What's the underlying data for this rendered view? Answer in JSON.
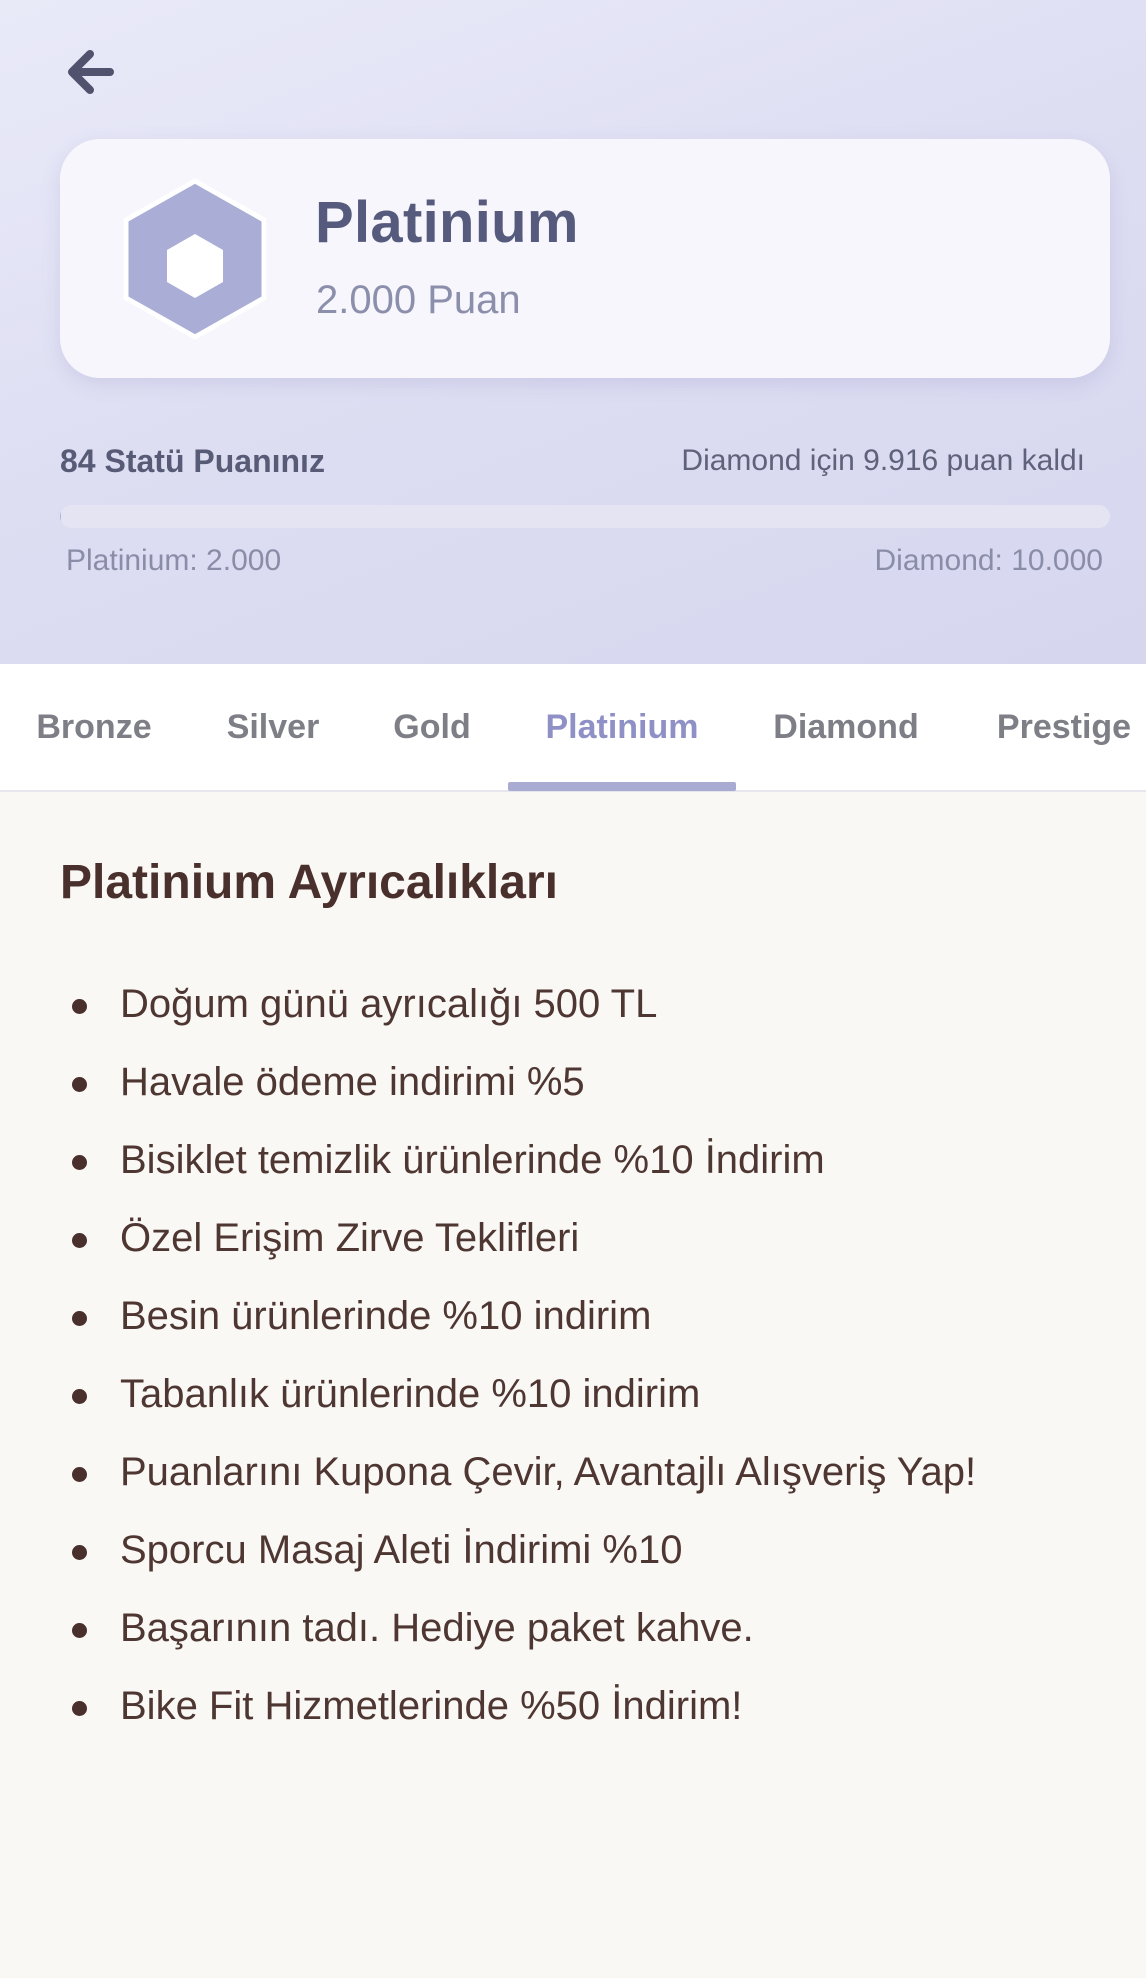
{
  "header": {
    "back_icon": "arrow-left-icon",
    "tier": {
      "icon": "hexagon-badge-icon",
      "name": "Platinium",
      "points": "2.000 Puan"
    },
    "status": {
      "label": "84 Statü Puanınız",
      "remaining": "Diamond için 9.916 puan kaldı",
      "progress_fraction": 0.001,
      "range_min": "Platinium: 2.000",
      "range_max": "Diamond: 10.000"
    }
  },
  "tabs": [
    {
      "label": "Bronze",
      "active": false
    },
    {
      "label": "Silver",
      "active": false
    },
    {
      "label": "Gold",
      "active": false
    },
    {
      "label": "Platinium",
      "active": true
    },
    {
      "label": "Diamond",
      "active": false
    },
    {
      "label": "Prestige",
      "active": false
    }
  ],
  "content": {
    "title": "Platinium Ayrıcalıkları",
    "benefits": [
      "Doğum günü ayrıcalığı 500 TL",
      "Havale ödeme indirimi %5",
      "Bisiklet temizlik ürünlerinde %10 İndirim",
      "Özel Erişim Zirve Teklifleri",
      "Besin ürünlerinde %10 indirim",
      "Tabanlık ürünlerinde %10 indirim",
      "Puanlarını Kupona Çevir, Avantajlı Alışveriş Yap!",
      "Sporcu Masaj Aleti İndirimi %10",
      "Başarının tadı. Hediye paket kahve.",
      "Bike Fit Hizmetlerinde %50 İndirim!"
    ]
  },
  "colors": {
    "header_bg": "#dcdcf2",
    "accent": "#a9abd2",
    "tier_text": "#565a7d",
    "content_text": "#4a302c",
    "page_bg": "#faf8f4"
  }
}
